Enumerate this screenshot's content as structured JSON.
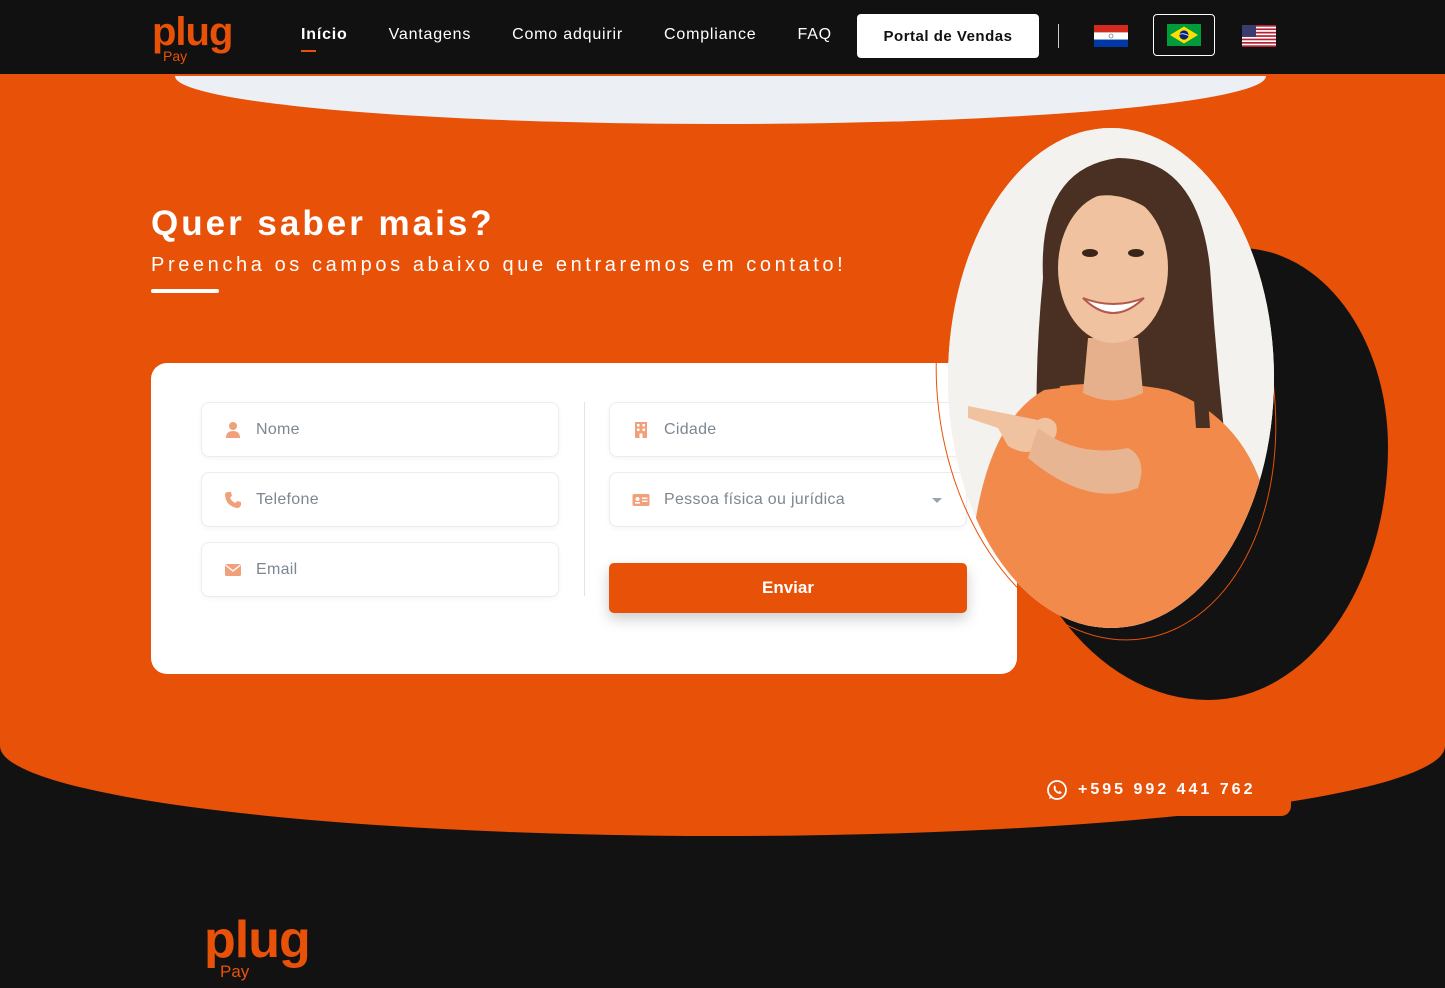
{
  "brand": {
    "name": "plug",
    "sub": "Pay",
    "color": "#e85108"
  },
  "nav": {
    "links": [
      {
        "label": "Início",
        "active": true
      },
      {
        "label": "Vantagens"
      },
      {
        "label": "Como adquirir"
      },
      {
        "label": "Compliance"
      },
      {
        "label": "FAQ"
      }
    ],
    "portal_button": "Portal de Vendas",
    "languages": [
      "paraguay-flag",
      "brazil-flag",
      "usa-flag"
    ],
    "selected_language": "brazil-flag"
  },
  "hero": {
    "title": "Quer saber mais?",
    "subtitle": "Preencha os campos abaixo que entraremos em contato!"
  },
  "form": {
    "name_placeholder": "Nome",
    "phone_placeholder": "Telefone",
    "email_placeholder": "Email",
    "city_placeholder": "Cidade",
    "person_type_placeholder": "Pessoa física ou jurídica",
    "submit_label": "Enviar"
  },
  "whatsapp": {
    "phone": "+595 992 441 762"
  },
  "colors": {
    "accent": "#e85108",
    "dark": "#121212",
    "white": "#ffffff"
  }
}
